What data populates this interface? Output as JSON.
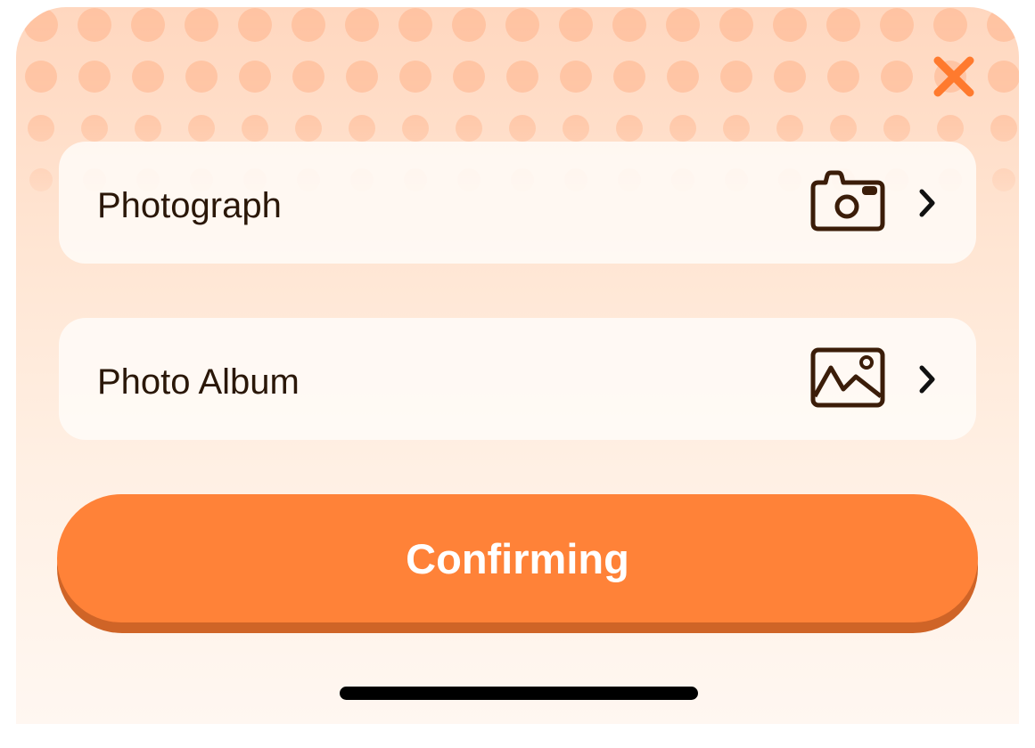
{
  "dialog": {
    "close_icon": "close-x-icon",
    "accent_color": "#ff8238",
    "background_top": "#ffd7bf",
    "background_bottom": "#fff7f1"
  },
  "options": [
    {
      "label": "Photograph",
      "icon": "camera-icon",
      "chevron": "chevron-right-icon"
    },
    {
      "label": "Photo Album",
      "icon": "image-icon",
      "chevron": "chevron-right-icon"
    }
  ],
  "confirm_button": {
    "label": "Confirming",
    "color": "#ff8238",
    "shadow_color": "#cf6427"
  },
  "home_indicator": {
    "color": "#000000"
  }
}
